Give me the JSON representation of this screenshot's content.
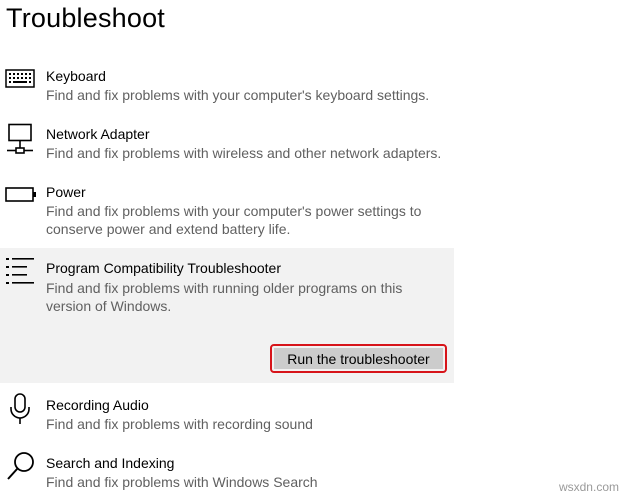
{
  "header": {
    "title": "Troubleshoot"
  },
  "items": [
    {
      "title": "Keyboard",
      "description": "Find and fix problems with your computer's keyboard settings.",
      "icon": "keyboard-icon"
    },
    {
      "title": "Network Adapter",
      "description": "Find and fix problems with wireless and other network adapters.",
      "icon": "network-adapter-icon"
    },
    {
      "title": "Power",
      "description": "Find and fix problems with your computer's power settings to conserve power and extend battery life.",
      "icon": "battery-icon"
    },
    {
      "title": "Program Compatibility Troubleshooter",
      "description": "Find and fix problems with running older programs on this version of Windows.",
      "icon": "program-list-icon",
      "selected": true,
      "button_label": "Run the troubleshooter"
    },
    {
      "title": "Recording Audio",
      "description": "Find and fix problems with recording sound",
      "icon": "microphone-icon"
    },
    {
      "title": "Search and Indexing",
      "description": "Find and fix problems with Windows Search",
      "icon": "search-icon"
    }
  ],
  "watermark": "wsxdn.com",
  "colors": {
    "highlight": "#d7141a",
    "selected_bg": "#f2f2f2",
    "button_bg": "#cccccc",
    "description_text": "#606060"
  }
}
